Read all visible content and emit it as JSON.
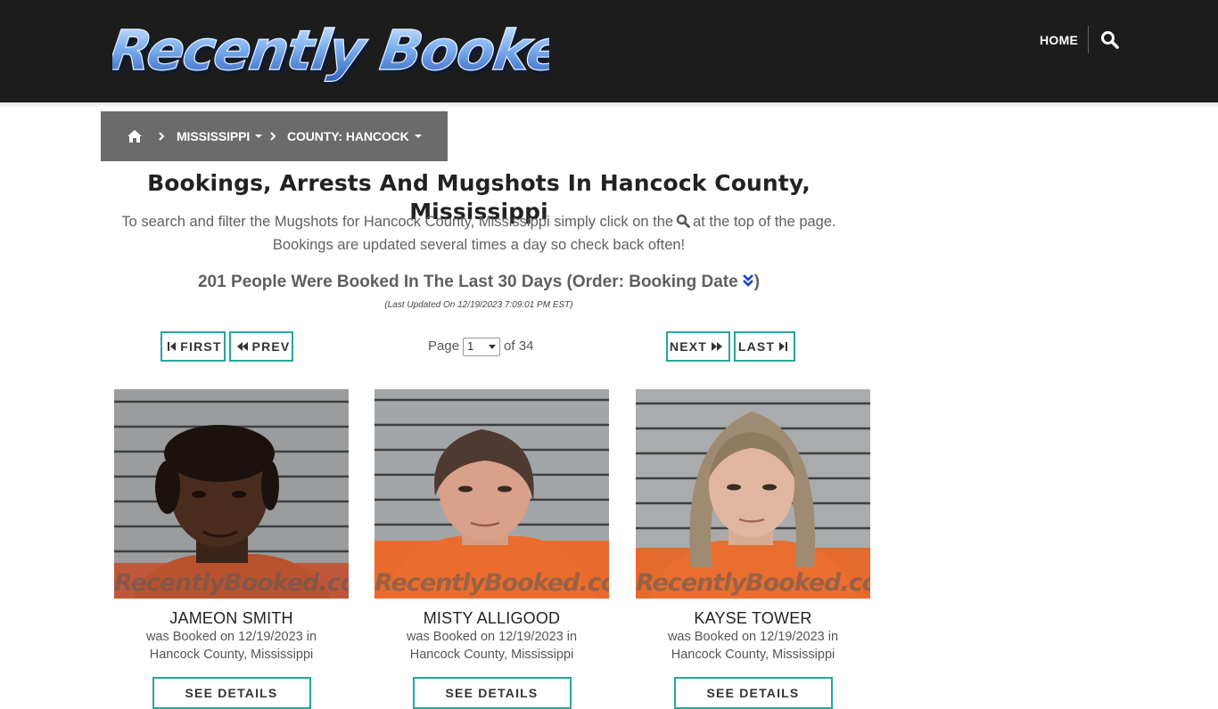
{
  "header": {
    "logo_text": "Recently Booked",
    "nav_home": "HOME",
    "search_icon": "search-icon"
  },
  "breadcrumb": {
    "home_icon": "home-icon",
    "state": "MISSISSIPPI",
    "county": "COUNTY: HANCOCK"
  },
  "main": {
    "title": "Bookings, Arrests And Mugshots In Hancock County, Mississippi",
    "desc_part1": "To search and filter the Mugshots for Hancock County, Mississippi simply click on the",
    "desc_part2": "at the top of the page.",
    "desc_line2": "Bookings are updated several times a day so check back often!",
    "count_text": "201 People Were Booked In The Last 30 Days (Order: Booking Date",
    "count_close": ")",
    "last_updated": "(Last Updated On 12/19/2023 7:09:01 PM EST)"
  },
  "pagination": {
    "first": "FIRST",
    "prev": "PREV",
    "page_label": "Page",
    "current_page": "1",
    "of_label": "of 34",
    "next": "NEXT",
    "last": "LAST"
  },
  "bookings": [
    {
      "name": "JAMEON SMITH",
      "line1": "was Booked on 12/19/2023 in",
      "line2": "Hancock County, Mississippi",
      "watermark": "RecentlyBooked.com",
      "button": "SEE DETAILS"
    },
    {
      "name": "MISTY ALLIGOOD",
      "line1": "was Booked on 12/19/2023 in",
      "line2": "Hancock County, Mississippi",
      "watermark": "RecentlyBooked.com",
      "button": "SEE DETAILS"
    },
    {
      "name": "KAYSE TOWER",
      "line1": "was Booked on 12/19/2023 in",
      "line2": "Hancock County, Mississippi",
      "watermark": "RecentlyBooked.com",
      "button": "SEE DETAILS"
    }
  ],
  "colors": {
    "topbar": "#1c1c1c",
    "breadcrumb_bg": "#6b6b6b",
    "accent_teal": "#26a69a",
    "logo_blue": "#4a7fd8",
    "sort_icon_blue": "#1a3fd6"
  }
}
